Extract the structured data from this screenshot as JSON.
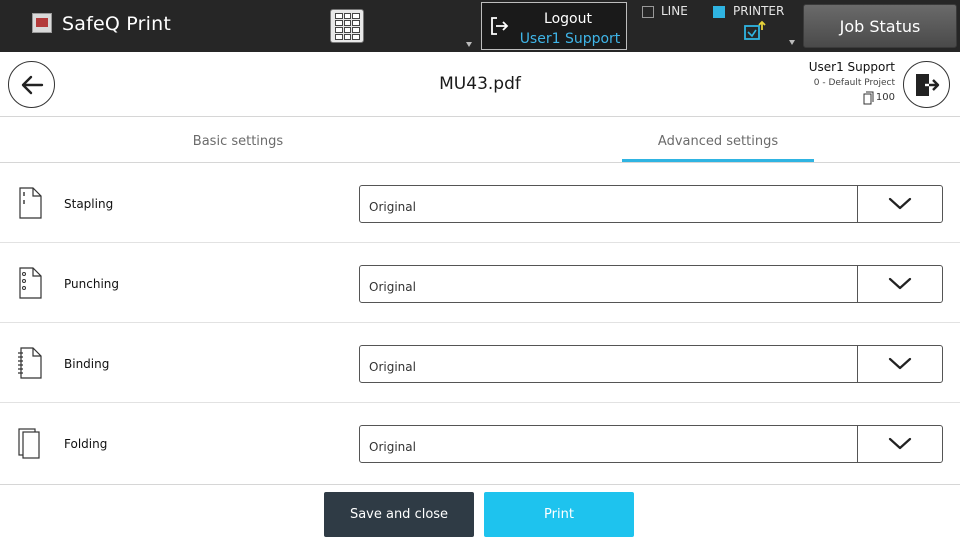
{
  "topbar": {
    "app_title": "SafeQ Print",
    "logout_label": "Logout",
    "logout_user": "User1  Support",
    "line_label": "LINE",
    "printer_label": "PRINTER",
    "job_status_label": "Job Status",
    "icons": {
      "logo": "safeq-logo-icon",
      "keypad": "keypad-icon",
      "logout": "logout-icon",
      "printer": "printer-transfer-icon"
    },
    "colors": {
      "bar": "#262626",
      "accent": "#2fb4e2",
      "user_text": "#3fb5e8"
    }
  },
  "header": {
    "file_title": "MU43.pdf",
    "user_name": "User1 Support",
    "user_project": "0 - Default Project",
    "credit": "100",
    "icons": {
      "back": "arrow-left-icon",
      "exit": "exit-icon",
      "credit": "document-icon"
    }
  },
  "tabs": [
    {
      "label": "Basic settings",
      "active": false
    },
    {
      "label": "Advanced settings",
      "active": true
    }
  ],
  "settings": [
    {
      "label": "Stapling",
      "value": "Original",
      "icon": "stapling-icon"
    },
    {
      "label": "Punching",
      "value": "Original",
      "icon": "punching-icon"
    },
    {
      "label": "Binding",
      "value": "Original",
      "icon": "binding-icon"
    },
    {
      "label": "Folding",
      "value": "Original",
      "icon": "folding-icon"
    }
  ],
  "footer": {
    "save_label": "Save and close",
    "print_label": "Print",
    "colors": {
      "save": "#2f3b45",
      "print": "#1ec3ee"
    }
  }
}
